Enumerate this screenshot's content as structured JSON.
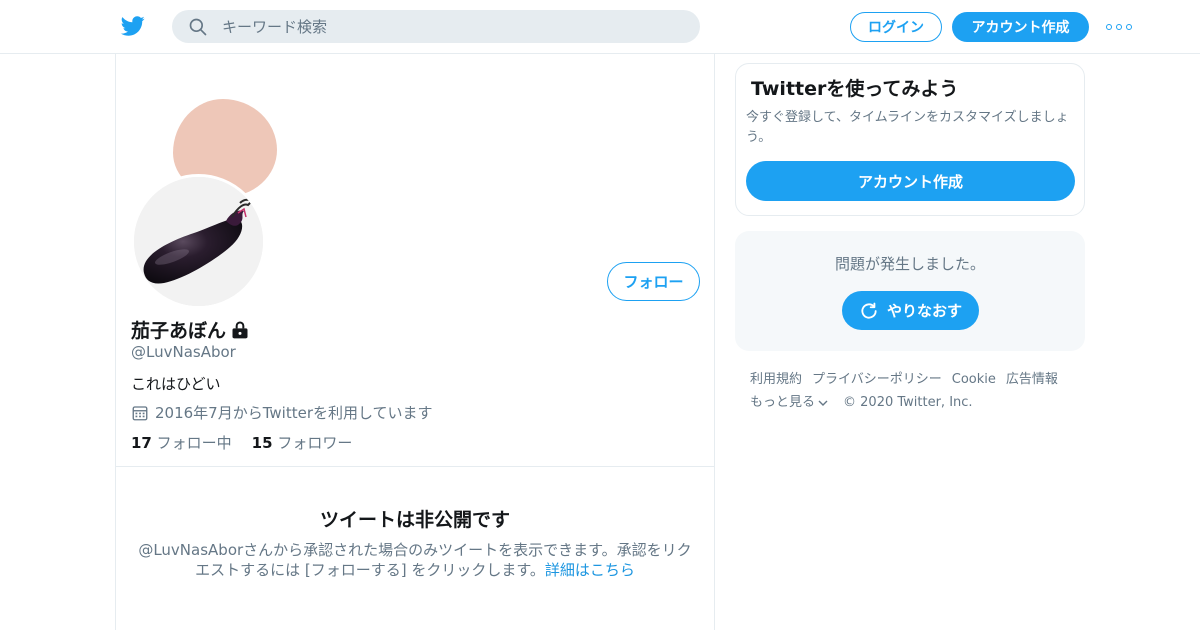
{
  "header": {
    "search_placeholder": "キーワード検索",
    "login_label": "ログイン",
    "signup_label": "アカウント作成",
    "brand_color": "#1da1f2"
  },
  "profile": {
    "display_name": "茄子あぼん",
    "handle": "@LuvNasAbor",
    "bio": "これはひどい",
    "joined": "2016年7月からTwitterを利用しています",
    "following_count": "17",
    "following_label": "フォロー中",
    "followers_count": "15",
    "followers_label": "フォロワー",
    "follow_button": "フォロー"
  },
  "private_notice": {
    "title": "ツイートは非公開です",
    "body": "@LuvNasAborさんから承認された場合のみツイートを表示できます。承認をリクエストするには [フォローする] をクリックします。",
    "link": "詳細はこちら"
  },
  "sidebar": {
    "signup_card": {
      "title": "Twitterを使ってみよう",
      "text": "今すぐ登録して、タイムラインをカスタマイズしましょう。",
      "button": "アカウント作成"
    },
    "error_card": {
      "message": "問題が発生しました。",
      "retry": "やりなおす"
    },
    "footer": {
      "links": [
        "利用規約",
        "プライバシーポリシー",
        "Cookie",
        "広告情報"
      ],
      "more": "もっと見る",
      "copyright": "© 2020 Twitter, Inc."
    }
  }
}
